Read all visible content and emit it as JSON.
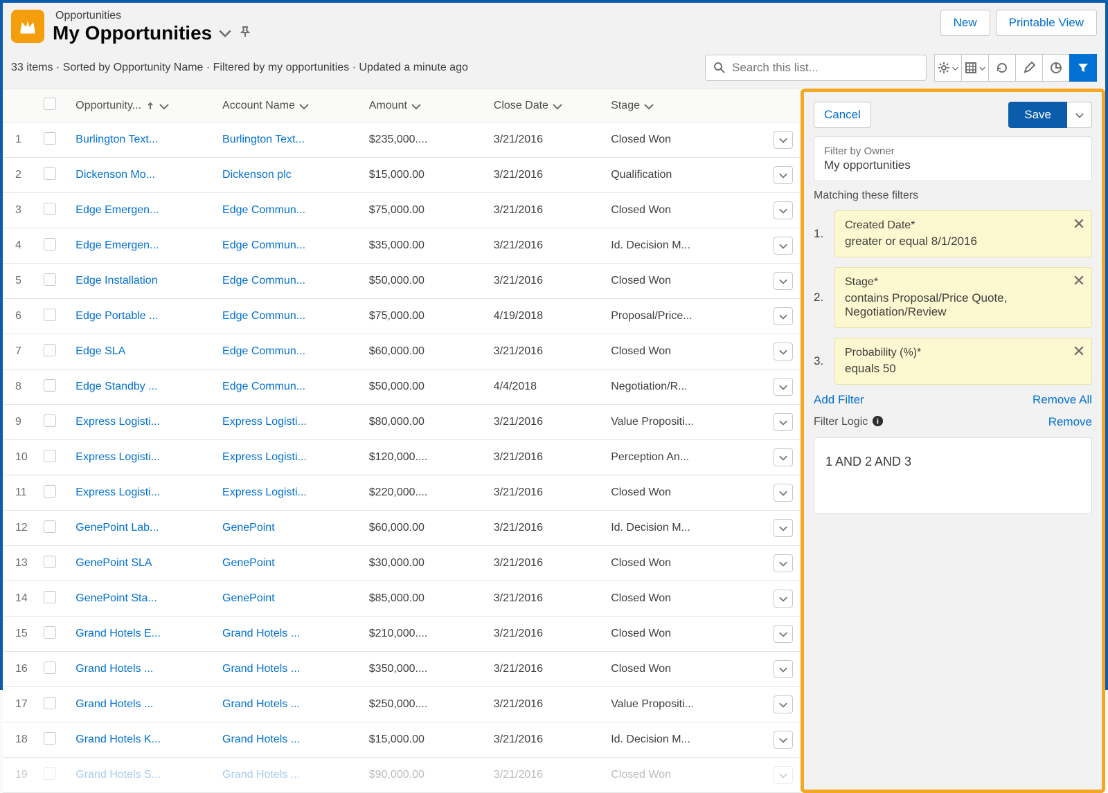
{
  "header": {
    "crumb": "Opportunities",
    "title": "My Opportunities",
    "new_button": "New",
    "printable_button": "Printable View"
  },
  "meta": {
    "text": "33 items · Sorted by Opportunity Name · Filtered by my opportunities · Updated a minute ago",
    "search_placeholder": "Search this list..."
  },
  "columns": {
    "opportunity": "Opportunity...",
    "account": "Account Name",
    "amount": "Amount",
    "close_date": "Close Date",
    "stage": "Stage"
  },
  "rows": [
    {
      "n": "1",
      "opp": "Burlington Text...",
      "acct": "Burlington Text...",
      "amt": "$235,000....",
      "date": "3/21/2016",
      "stage": "Closed Won"
    },
    {
      "n": "2",
      "opp": "Dickenson Mo...",
      "acct": "Dickenson plc",
      "amt": "$15,000.00",
      "date": "3/21/2016",
      "stage": "Qualification"
    },
    {
      "n": "3",
      "opp": "Edge Emergen...",
      "acct": "Edge Commun...",
      "amt": "$75,000.00",
      "date": "3/21/2016",
      "stage": "Closed Won"
    },
    {
      "n": "4",
      "opp": "Edge Emergen...",
      "acct": "Edge Commun...",
      "amt": "$35,000.00",
      "date": "3/21/2016",
      "stage": "Id. Decision M..."
    },
    {
      "n": "5",
      "opp": "Edge Installation",
      "acct": "Edge Commun...",
      "amt": "$50,000.00",
      "date": "3/21/2016",
      "stage": "Closed Won"
    },
    {
      "n": "6",
      "opp": "Edge Portable ...",
      "acct": "Edge Commun...",
      "amt": "$75,000.00",
      "date": "4/19/2018",
      "stage": "Proposal/Price..."
    },
    {
      "n": "7",
      "opp": "Edge SLA",
      "acct": "Edge Commun...",
      "amt": "$60,000.00",
      "date": "3/21/2016",
      "stage": "Closed Won"
    },
    {
      "n": "8",
      "opp": "Edge Standby ...",
      "acct": "Edge Commun...",
      "amt": "$50,000.00",
      "date": "4/4/2018",
      "stage": "Negotiation/R..."
    },
    {
      "n": "9",
      "opp": "Express Logisti...",
      "acct": "Express Logisti...",
      "amt": "$80,000.00",
      "date": "3/21/2016",
      "stage": "Value Propositi..."
    },
    {
      "n": "10",
      "opp": "Express Logisti...",
      "acct": "Express Logisti...",
      "amt": "$120,000....",
      "date": "3/21/2016",
      "stage": "Perception An..."
    },
    {
      "n": "11",
      "opp": "Express Logisti...",
      "acct": "Express Logisti...",
      "amt": "$220,000....",
      "date": "3/21/2016",
      "stage": "Closed Won"
    },
    {
      "n": "12",
      "opp": "GenePoint Lab...",
      "acct": "GenePoint",
      "amt": "$60,000.00",
      "date": "3/21/2016",
      "stage": "Id. Decision M..."
    },
    {
      "n": "13",
      "opp": "GenePoint SLA",
      "acct": "GenePoint",
      "amt": "$30,000.00",
      "date": "3/21/2016",
      "stage": "Closed Won"
    },
    {
      "n": "14",
      "opp": "GenePoint Sta...",
      "acct": "GenePoint",
      "amt": "$85,000.00",
      "date": "3/21/2016",
      "stage": "Closed Won"
    },
    {
      "n": "15",
      "opp": "Grand Hotels E...",
      "acct": "Grand Hotels ...",
      "amt": "$210,000....",
      "date": "3/21/2016",
      "stage": "Closed Won"
    },
    {
      "n": "16",
      "opp": "Grand Hotels ...",
      "acct": "Grand Hotels ...",
      "amt": "$350,000....",
      "date": "3/21/2016",
      "stage": "Closed Won"
    },
    {
      "n": "17",
      "opp": "Grand Hotels ...",
      "acct": "Grand Hotels ...",
      "amt": "$250,000....",
      "date": "3/21/2016",
      "stage": "Value Propositi..."
    },
    {
      "n": "18",
      "opp": "Grand Hotels K...",
      "acct": "Grand Hotels ...",
      "amt": "$15,000.00",
      "date": "3/21/2016",
      "stage": "Id. Decision M..."
    },
    {
      "n": "19",
      "opp": "Grand Hotels S...",
      "acct": "Grand Hotels ...",
      "amt": "$90,000.00",
      "date": "3/21/2016",
      "stage": "Closed Won"
    }
  ],
  "filter_panel": {
    "cancel": "Cancel",
    "save": "Save",
    "owner_label": "Filter by Owner",
    "owner_value": "My opportunities",
    "matching_label": "Matching these filters",
    "filters": [
      {
        "idx": "1.",
        "field": "Created Date*",
        "cond": "greater or equal  8/1/2016"
      },
      {
        "idx": "2.",
        "field": "Stage*",
        "cond": "contains  Proposal/Price Quote, Negotiation/Review"
      },
      {
        "idx": "3.",
        "field": "Probability (%)*",
        "cond": "equals  50"
      }
    ],
    "add_filter": "Add Filter",
    "remove_all": "Remove All",
    "logic_label": "Filter Logic",
    "logic_remove": "Remove",
    "logic_value": "1 AND 2 AND 3"
  }
}
